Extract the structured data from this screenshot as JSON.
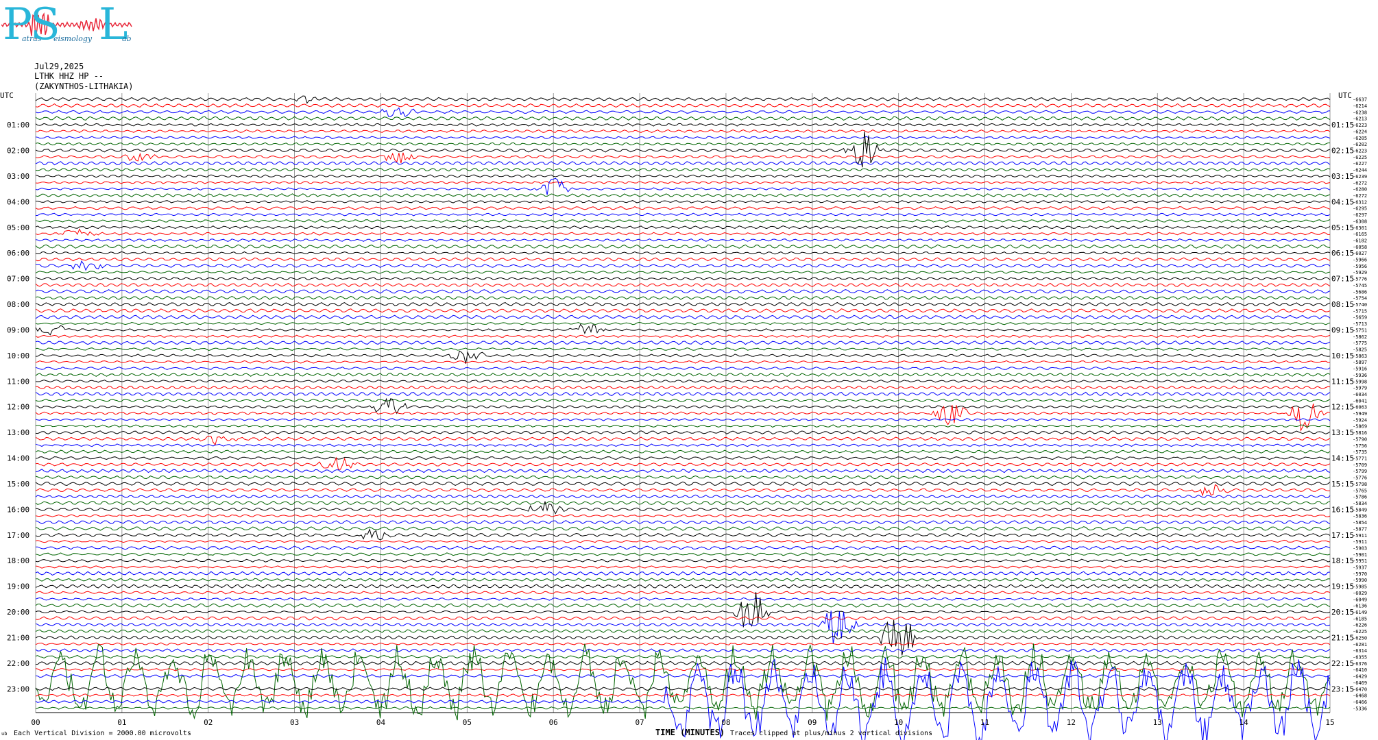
{
  "logo": {
    "letter_p": "P",
    "letter_s": "S",
    "letter_l": "L",
    "word1": "atras",
    "word2": "eismology",
    "word3": "ab",
    "wave_color": "#e8283a"
  },
  "header": {
    "date": "Jul29,2025",
    "station": "LTHK HHZ HP --",
    "location": "(ZAKYNTHOS-LITHAKIA)"
  },
  "footer": {
    "vertical_division": "Each Vertical Division = 2000.00 microvolts",
    "xlabel": "TIME (MINUTES)",
    "clipping_note": "Traces clipped at plus/minus 2 vertical divisions",
    "corner_mark": "ub"
  },
  "colors": {
    "trace_cycle": [
      "#000000",
      "#ff0000",
      "#0000ff",
      "#006400"
    ],
    "grid": "#808080"
  },
  "chart_data": {
    "type": "line",
    "title": "Jul29,2025",
    "xlabel": "TIME (MINUTES)",
    "ylabel": "UTC",
    "xlim": [
      0,
      15
    ],
    "x_ticks": [
      "00",
      "01",
      "02",
      "03",
      "04",
      "05",
      "06",
      "07",
      "08",
      "09",
      "10",
      "11",
      "12",
      "13",
      "14",
      "15"
    ],
    "left_axis_title": "UTC",
    "right_axis_title": "UTC",
    "left_labels": [
      "01:00",
      "02:00",
      "03:00",
      "04:00",
      "05:00",
      "06:00",
      "07:00",
      "08:00",
      "09:00",
      "10:00",
      "11:00",
      "12:00",
      "13:00",
      "14:00",
      "15:00",
      "16:00",
      "17:00",
      "18:00",
      "19:00",
      "20:00",
      "21:00",
      "22:00",
      "23:00"
    ],
    "right_labels": [
      "01:15",
      "02:15",
      "03:15",
      "04:15",
      "05:15",
      "06:15",
      "07:15",
      "08:15",
      "09:15",
      "10:15",
      "11:15",
      "12:15",
      "13:15",
      "14:15",
      "15:15",
      "16:15",
      "17:15",
      "18:15",
      "19:15",
      "20:15",
      "21:15",
      "22:15",
      "23:15"
    ],
    "trace_count": 96,
    "traces_per_hour": 4,
    "trace_offsets": [
      "-6637",
      "-6214",
      "-6238",
      "-6213",
      "-6223",
      "-6224",
      "-6205",
      "-6202",
      "-6223",
      "-6225",
      "-6227",
      "-6244",
      "-6239",
      "-6272",
      "-6280",
      "-6272",
      "-6312",
      "-6295",
      "-6297",
      "-6308",
      "-6301",
      "-6165",
      "-6182",
      "-6058",
      "-6027",
      "-5966",
      "-5956",
      "-5929",
      "-5776",
      "-5745",
      "-5686",
      "-5754",
      "-5740",
      "-5715",
      "-5659",
      "-5713",
      "-5751",
      "-5862",
      "-5775",
      "-5825",
      "-5863",
      "-5897",
      "-5916",
      "-5936",
      "-5998",
      "-5979",
      "-6034",
      "-6041",
      "-6063",
      "-5949",
      "-5924",
      "-5869",
      "-5816",
      "-5790",
      "-5756",
      "-5735",
      "-5771",
      "-5709",
      "-5799",
      "-5776",
      "-5798",
      "-5765",
      "-5786",
      "-5834",
      "-5849",
      "-5836",
      "-5854",
      "-5877",
      "-5911",
      "-5911",
      "-5903",
      "-5901",
      "-5951",
      "-5937",
      "-5970",
      "-5990",
      "-5985",
      "-6029",
      "-6049",
      "-6136",
      "-6149",
      "-6185",
      "-6226",
      "-6225",
      "-6250",
      "-6281",
      "-6314",
      "-6355",
      "-6376",
      "-6410",
      "-6429",
      "-6469",
      "-6470",
      "-6468",
      "-6466",
      "-5336"
    ],
    "events": [
      {
        "trace": 0,
        "minute": 3.1,
        "amp": 0.6
      },
      {
        "trace": 2,
        "minute": 4.2,
        "amp": 1.2
      },
      {
        "trace": 8,
        "minute": 9.6,
        "amp": 3.2
      },
      {
        "trace": 9,
        "minute": 1.2,
        "amp": 1.0
      },
      {
        "trace": 9,
        "minute": 4.2,
        "amp": 1.0
      },
      {
        "trace": 14,
        "minute": 6.0,
        "amp": 2.0
      },
      {
        "trace": 21,
        "minute": 0.5,
        "amp": 1.0
      },
      {
        "trace": 26,
        "minute": 0.6,
        "amp": 1.0
      },
      {
        "trace": 36,
        "minute": 0.2,
        "amp": 1.0
      },
      {
        "trace": 36,
        "minute": 6.4,
        "amp": 1.4
      },
      {
        "trace": 40,
        "minute": 5.0,
        "amp": 1.6
      },
      {
        "trace": 48,
        "minute": 4.1,
        "amp": 1.8
      },
      {
        "trace": 49,
        "minute": 10.6,
        "amp": 2.2
      },
      {
        "trace": 49,
        "minute": 14.7,
        "amp": 3.5
      },
      {
        "trace": 53,
        "minute": 2.1,
        "amp": 1.2
      },
      {
        "trace": 57,
        "minute": 3.5,
        "amp": 1.6
      },
      {
        "trace": 61,
        "minute": 13.6,
        "amp": 1.5
      },
      {
        "trace": 64,
        "minute": 5.9,
        "amp": 1.4
      },
      {
        "trace": 68,
        "minute": 3.9,
        "amp": 1.2
      },
      {
        "trace": 80,
        "minute": 8.3,
        "amp": 4.0
      },
      {
        "trace": 82,
        "minute": 9.3,
        "amp": 4.5
      },
      {
        "trace": 84,
        "minute": 10.0,
        "amp": 5.0
      }
    ],
    "tremor_bands": [
      {
        "trace": 91,
        "from_minute": 0.0,
        "to_minute": 15.0,
        "amp": 6.0
      },
      {
        "trace": 94,
        "from_minute": 7.3,
        "to_minute": 15.0,
        "amp": 7.0
      }
    ],
    "grid": true
  }
}
